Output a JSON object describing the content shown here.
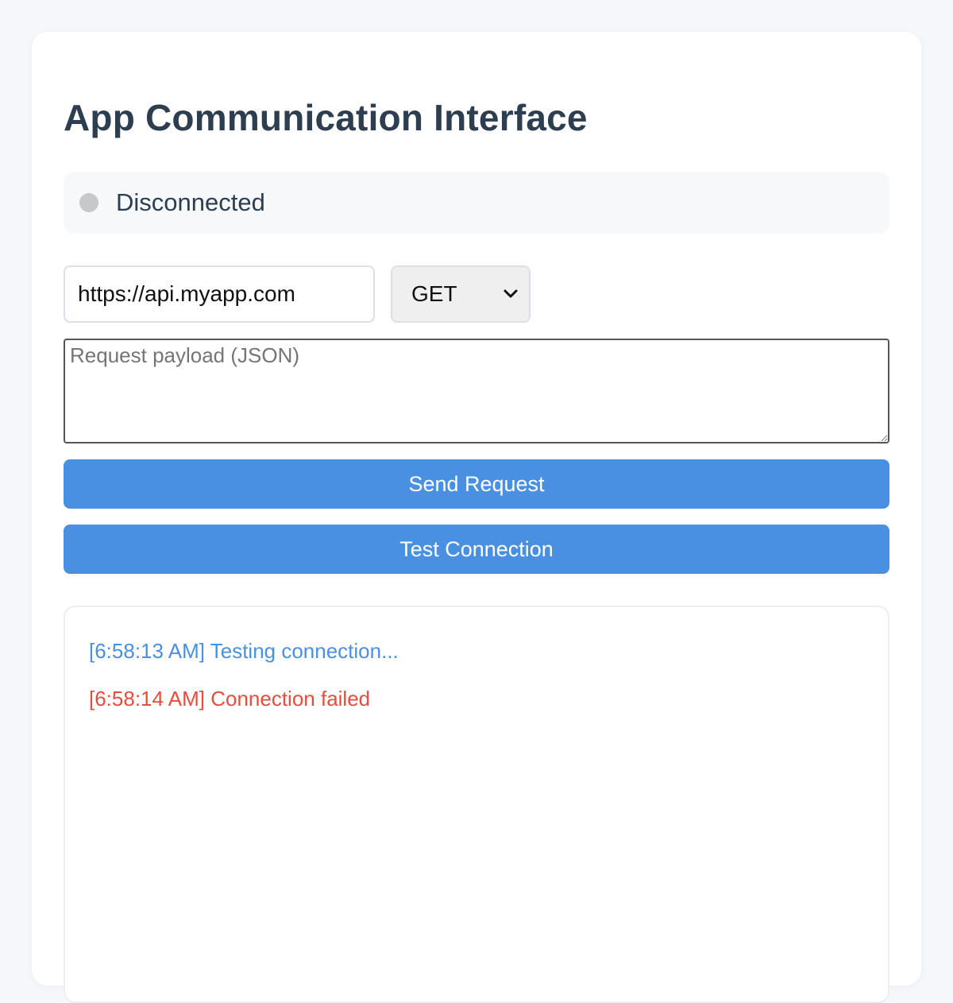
{
  "page": {
    "title": "App Communication Interface"
  },
  "status": {
    "text": "Disconnected",
    "dot_color": "#c8c8c8"
  },
  "request": {
    "url_value": "https://api.myapp.com",
    "method_selected": "GET",
    "payload_placeholder": "Request payload (JSON)",
    "payload_value": ""
  },
  "buttons": {
    "send_label": "Send Request",
    "test_label": "Test Connection",
    "color": "#4a90e2"
  },
  "log": {
    "entries": [
      {
        "text": "[6:58:13 AM] Testing connection...",
        "level": "info",
        "color": "#4a90e2"
      },
      {
        "text": "[6:58:14 AM] Connection failed",
        "level": "error",
        "color": "#e74c3c"
      }
    ]
  }
}
